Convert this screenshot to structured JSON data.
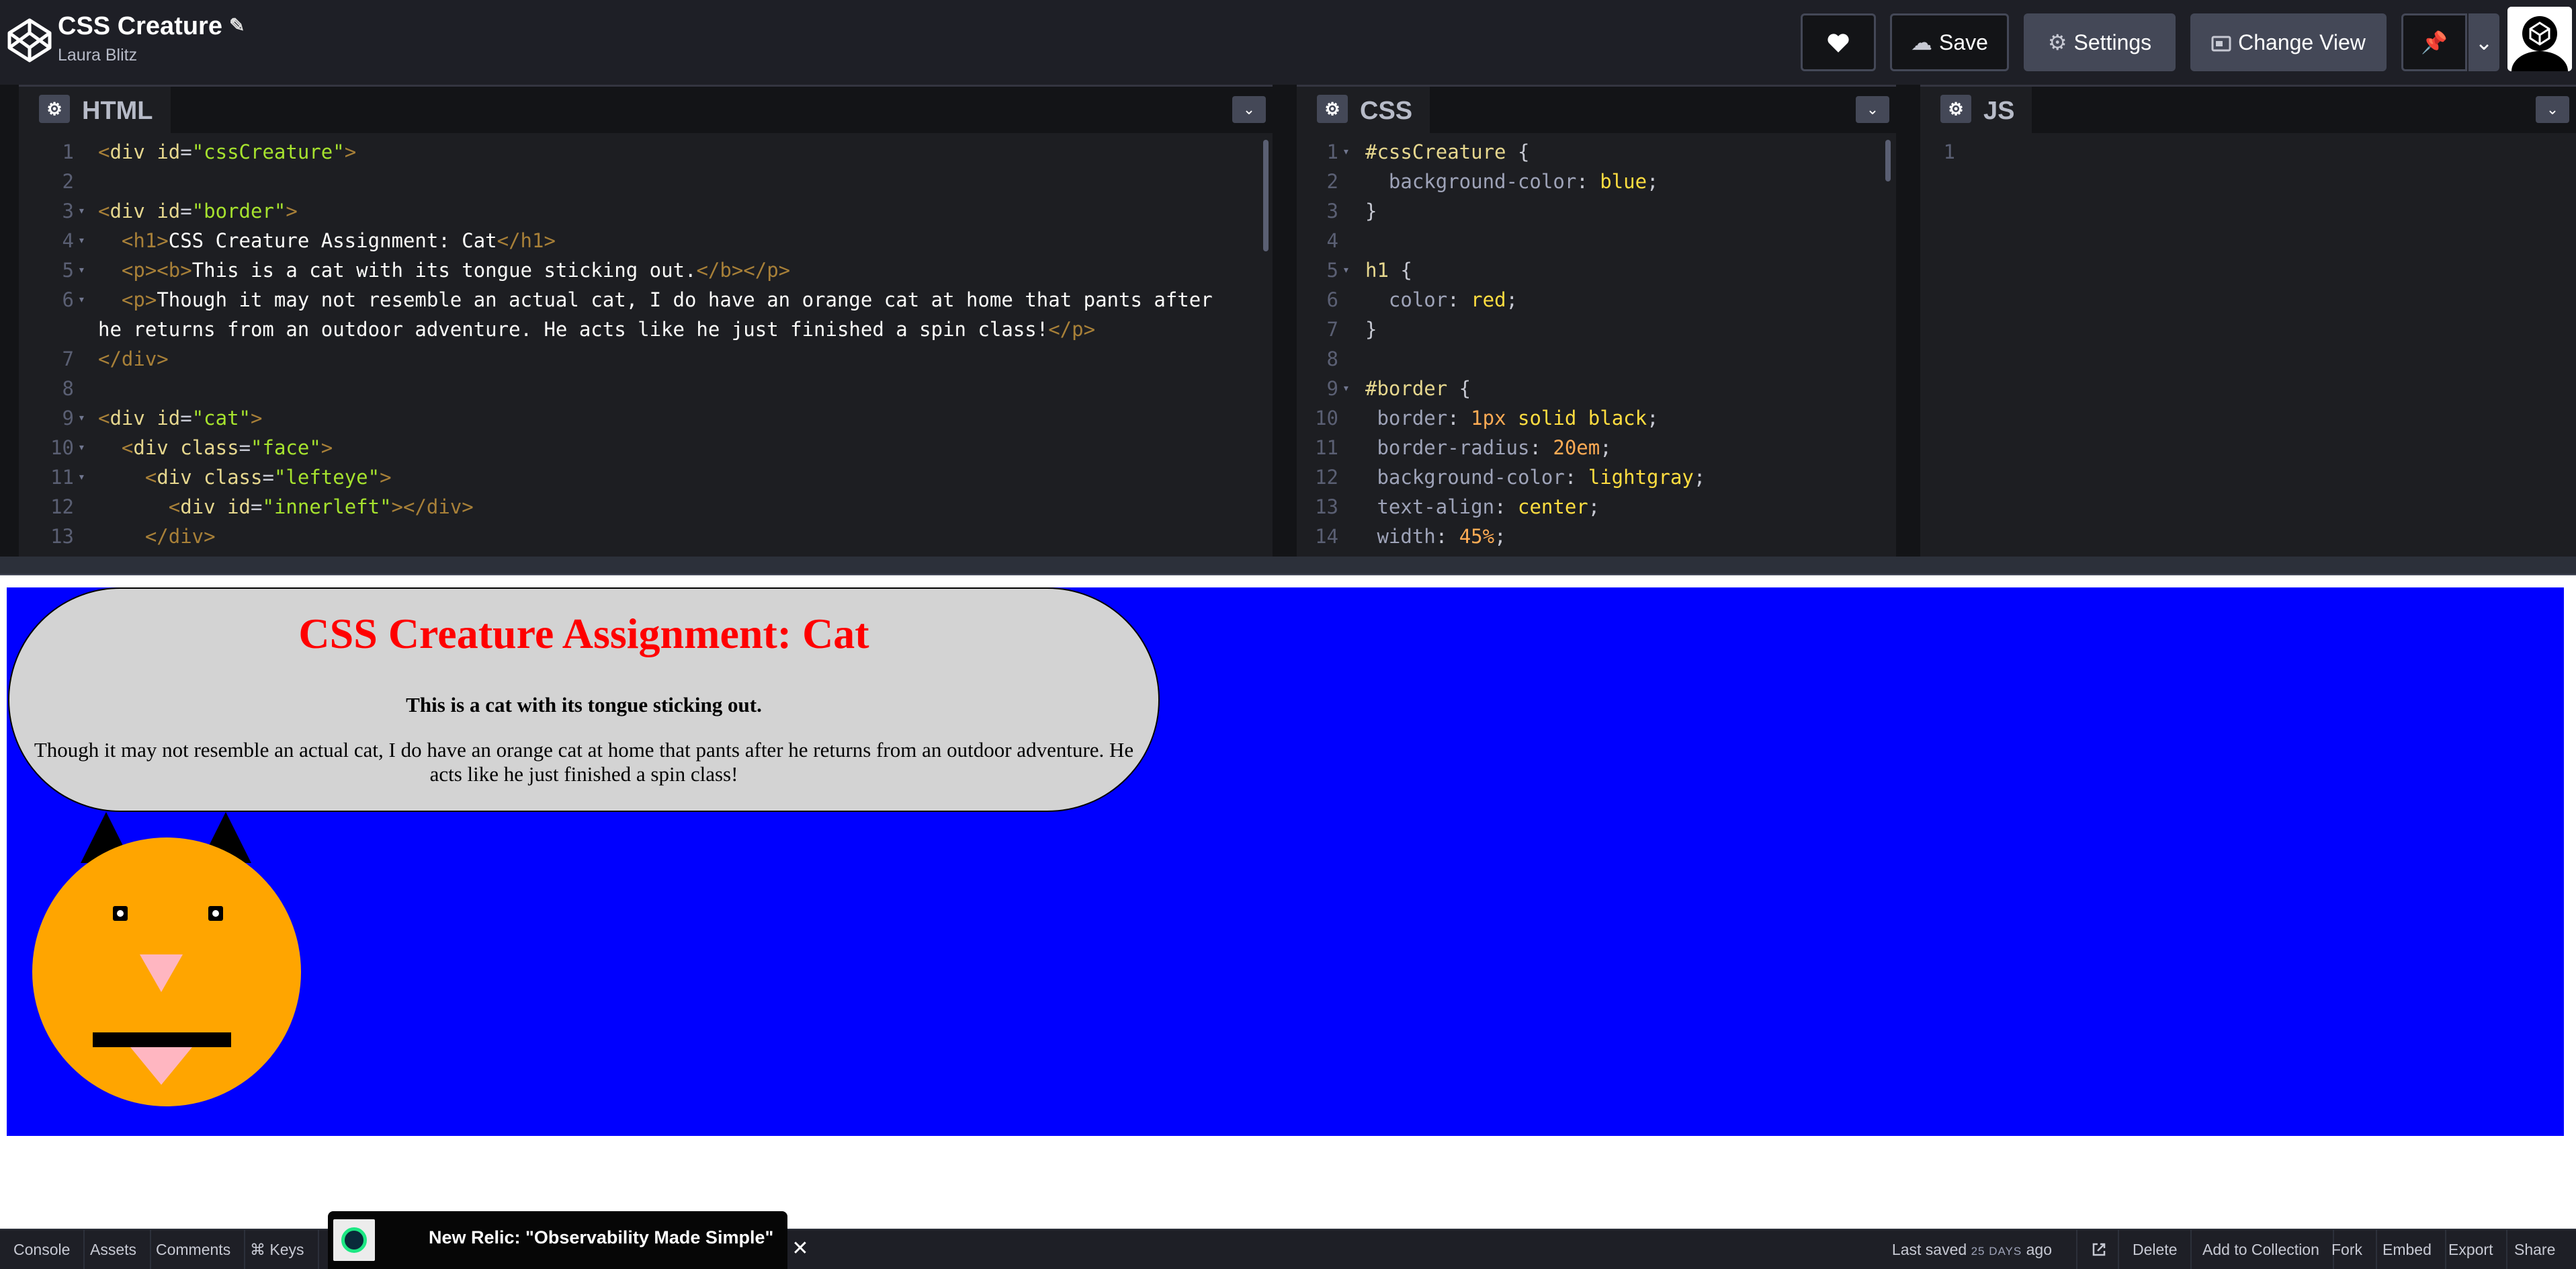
{
  "header": {
    "title": "CSS Creature",
    "author": "Laura Blitz",
    "save_label": "Save",
    "settings_label": "Settings",
    "change_view_label": "Change View"
  },
  "editors": {
    "html": {
      "label": "HTML",
      "line_numbers": [
        "1",
        "2",
        "3",
        "4",
        "5",
        "6",
        "7",
        "8",
        "9",
        "10",
        "11",
        "12",
        "13"
      ],
      "lines": [
        [
          "<div id=\"cssCreature\">"
        ],
        [
          ""
        ],
        [
          "<div id=\"border\">"
        ],
        [
          "  <h1>CSS Creature Assignment: Cat</h1>"
        ],
        [
          "  <p><b>This is a cat with its tongue sticking out.</b></p>"
        ],
        [
          "  <p>Though it may not resemble an actual cat, I do have an orange cat at home that pants after",
          "he returns from an outdoor adventure. He acts like he just finished a spin class!</p>"
        ],
        [
          "</div>"
        ],
        [
          ""
        ],
        [
          "<div id=\"cat\">"
        ],
        [
          "  <div class=\"face\">"
        ],
        [
          "    <div class=\"lefteye\">"
        ],
        [
          "      <div id=\"innerleft\"></div>"
        ],
        [
          "    </div>"
        ]
      ]
    },
    "css": {
      "label": "CSS",
      "line_numbers": [
        "1",
        "2",
        "3",
        "4",
        "5",
        "6",
        "7",
        "8",
        "9",
        "10",
        "11",
        "12",
        "13",
        "14"
      ],
      "lines": [
        "#cssCreature {",
        "  background-color: blue;",
        "}",
        "",
        "h1 {",
        "  color: red;",
        "}",
        "",
        "#border {",
        " border: 1px solid black;",
        " border-radius: 20em;",
        " background-color: lightgray;",
        " text-align: center;",
        " width: 45%;"
      ]
    },
    "js": {
      "label": "JS",
      "line_numbers": [
        "1"
      ]
    }
  },
  "preview": {
    "heading": "CSS Creature Assignment: Cat",
    "subheading": "This is a cat with its tongue sticking out.",
    "paragraph": "Though it may not resemble an actual cat, I do have an orange cat at home that pants after he returns from an outdoor adventure. He acts like he just finished a spin class!",
    "colors": {
      "background": "#0000ff",
      "bubble": "#d3d3d3",
      "heading": "#ff0000",
      "face": "#ffa500",
      "nose_tongue": "#ffb6c1"
    }
  },
  "ad": {
    "text": "New Relic: \"Observability Made Simple\"",
    "close_label": "✕"
  },
  "footer": {
    "left_buttons": [
      "Console",
      "Assets",
      "Comments",
      "⌘ Keys"
    ],
    "last_saved_prefix": "Last saved",
    "last_saved_value": "25 DAYS",
    "last_saved_suffix": "ago",
    "right_buttons": [
      "Delete",
      "Add to Collection",
      "Fork",
      "Embed",
      "Export",
      "Share"
    ]
  },
  "icons": {
    "logo": "codepen-logo-icon",
    "edit": "pencil-icon",
    "like": "heart-icon",
    "save": "cloud-icon",
    "settings": "gear-icon",
    "change_view": "layout-icon",
    "pin": "pin-icon",
    "dropdown": "chevron-down-icon",
    "open_external": "external-link-icon"
  }
}
